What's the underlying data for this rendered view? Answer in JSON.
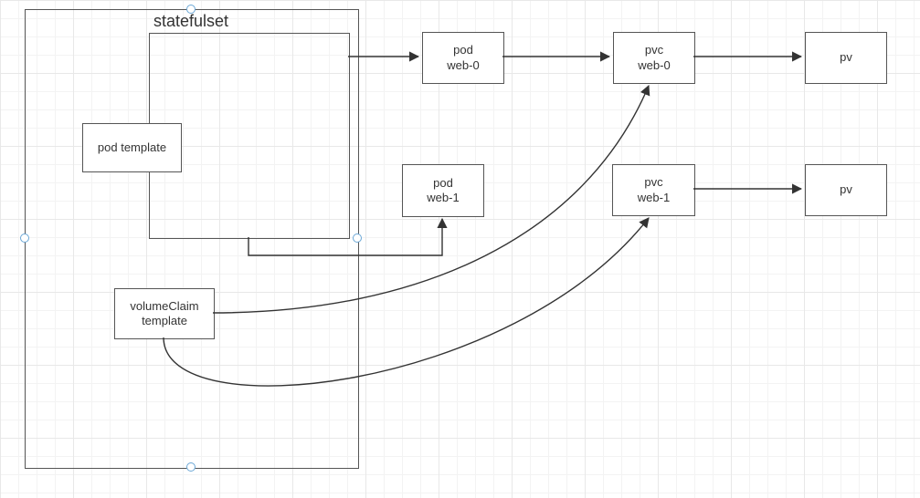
{
  "diagram": {
    "title": "statefulset",
    "nodes": {
      "podTemplate": {
        "line1": "pod template"
      },
      "volumeClaimTemplate": {
        "line1": "volumeClaim",
        "line2": "template"
      },
      "pod0": {
        "line1": "pod",
        "line2": "web-0"
      },
      "pod1": {
        "line1": "pod",
        "line2": "web-1"
      },
      "pvc0": {
        "line1": "pvc",
        "line2": "web-0"
      },
      "pvc1": {
        "line1": "pvc",
        "line2": "web-1"
      },
      "pv0": {
        "line1": "pv"
      },
      "pv1": {
        "line1": "pv"
      }
    }
  },
  "chart_data": {
    "type": "diagram",
    "title": "statefulset",
    "nodes": [
      {
        "id": "statefulset",
        "label": "statefulset",
        "kind": "container"
      },
      {
        "id": "podTemplate",
        "label": "pod template",
        "parent": "statefulset"
      },
      {
        "id": "volumeClaimTemplate",
        "label": "volumeClaim template",
        "parent": "statefulset"
      },
      {
        "id": "pod-web-0",
        "label": "pod web-0"
      },
      {
        "id": "pod-web-1",
        "label": "pod web-1"
      },
      {
        "id": "pvc-web-0",
        "label": "pvc web-0"
      },
      {
        "id": "pvc-web-1",
        "label": "pvc web-1"
      },
      {
        "id": "pv-0",
        "label": "pv"
      },
      {
        "id": "pv-1",
        "label": "pv"
      }
    ],
    "edges": [
      {
        "from": "podTemplate",
        "to": "pod-web-0"
      },
      {
        "from": "podTemplate",
        "to": "pod-web-1"
      },
      {
        "from": "pod-web-0",
        "to": "pvc-web-0"
      },
      {
        "from": "pvc-web-0",
        "to": "pv-0"
      },
      {
        "from": "pvc-web-1",
        "to": "pv-1"
      },
      {
        "from": "volumeClaimTemplate",
        "to": "pvc-web-0"
      },
      {
        "from": "volumeClaimTemplate",
        "to": "pvc-web-1"
      }
    ]
  }
}
